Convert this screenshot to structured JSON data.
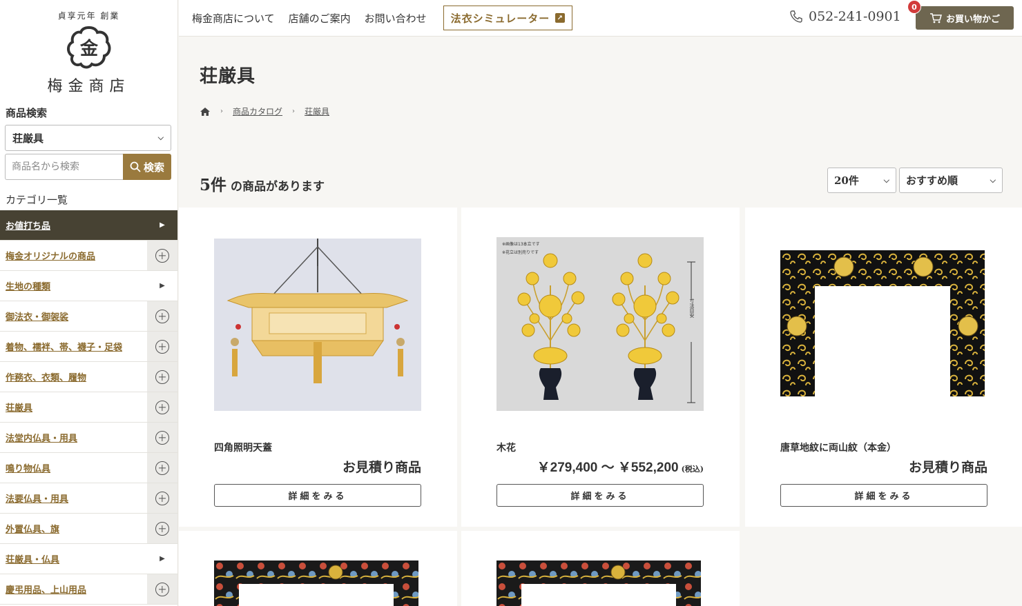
{
  "brand": {
    "established": "貞享元年 創業",
    "logo_char": "金",
    "name": "梅金商店"
  },
  "sidebar": {
    "search_heading": "商品検索",
    "category_select_value": "荘厳具",
    "search_placeholder": "商品名から検索",
    "search_button": "検索",
    "category_heading": "カテゴリ一覧",
    "categories": [
      {
        "label": "お値打ち品",
        "toggle": "arrow"
      },
      {
        "label": "梅金オリジナルの商品",
        "toggle": "plus"
      },
      {
        "label": "生地の種類",
        "toggle": "arrow"
      },
      {
        "label": "御法衣・御袈裟",
        "toggle": "plus"
      },
      {
        "label": "着物、襦袢、帯、襪子・足袋",
        "toggle": "plus"
      },
      {
        "label": "作務衣、衣類、履物",
        "toggle": "plus"
      },
      {
        "label": "荘厳具",
        "toggle": "plus"
      },
      {
        "label": "法堂内仏具・用具",
        "toggle": "plus"
      },
      {
        "label": "鳴り物仏具",
        "toggle": "plus"
      },
      {
        "label": "法要仏具・用具",
        "toggle": "plus"
      },
      {
        "label": "外置仏具、旗",
        "toggle": "plus"
      },
      {
        "label": "荘厳具・仏具",
        "toggle": "arrow"
      },
      {
        "label": "慶弔用品、上山用品",
        "toggle": "plus"
      }
    ]
  },
  "header": {
    "nav": [
      "梅金商店について",
      "店舗のご案内",
      "お問い合わせ"
    ],
    "simulator": "法衣シミュレーター",
    "phone": "052-241-0901",
    "cart_label": "お買い物かご",
    "cart_count": "0"
  },
  "main": {
    "title": "荘厳具",
    "breadcrumb": [
      "商品カタログ",
      "荘厳具"
    ],
    "count_num": "5件",
    "count_text": "の商品があります",
    "per_page": "20件",
    "sort": "おすすめ順"
  },
  "products": [
    {
      "name": "四角照明天蓋",
      "price": "お見積り商品",
      "tax": "",
      "button": "詳細をみる"
    },
    {
      "name": "木花",
      "price": "￥279,400 〜 ￥552,200",
      "tax": "(税込)",
      "button": "詳細をみる",
      "img_notes": [
        "※画像は13本立です",
        "※花立は別売りです"
      ],
      "dim_label": "寸法目安"
    },
    {
      "name": "唐草地紋に両山紋（本金）",
      "price": "お見積り商品",
      "tax": "",
      "button": "詳細をみる"
    },
    {
      "name": "",
      "price": "",
      "tax": "",
      "button": ""
    },
    {
      "name": "",
      "price": "",
      "tax": "",
      "button": ""
    }
  ],
  "colors": {
    "accent": "#9a7a3e",
    "active_category": "#474233",
    "cart": "#6e6650",
    "badge": "#d23b3b"
  }
}
